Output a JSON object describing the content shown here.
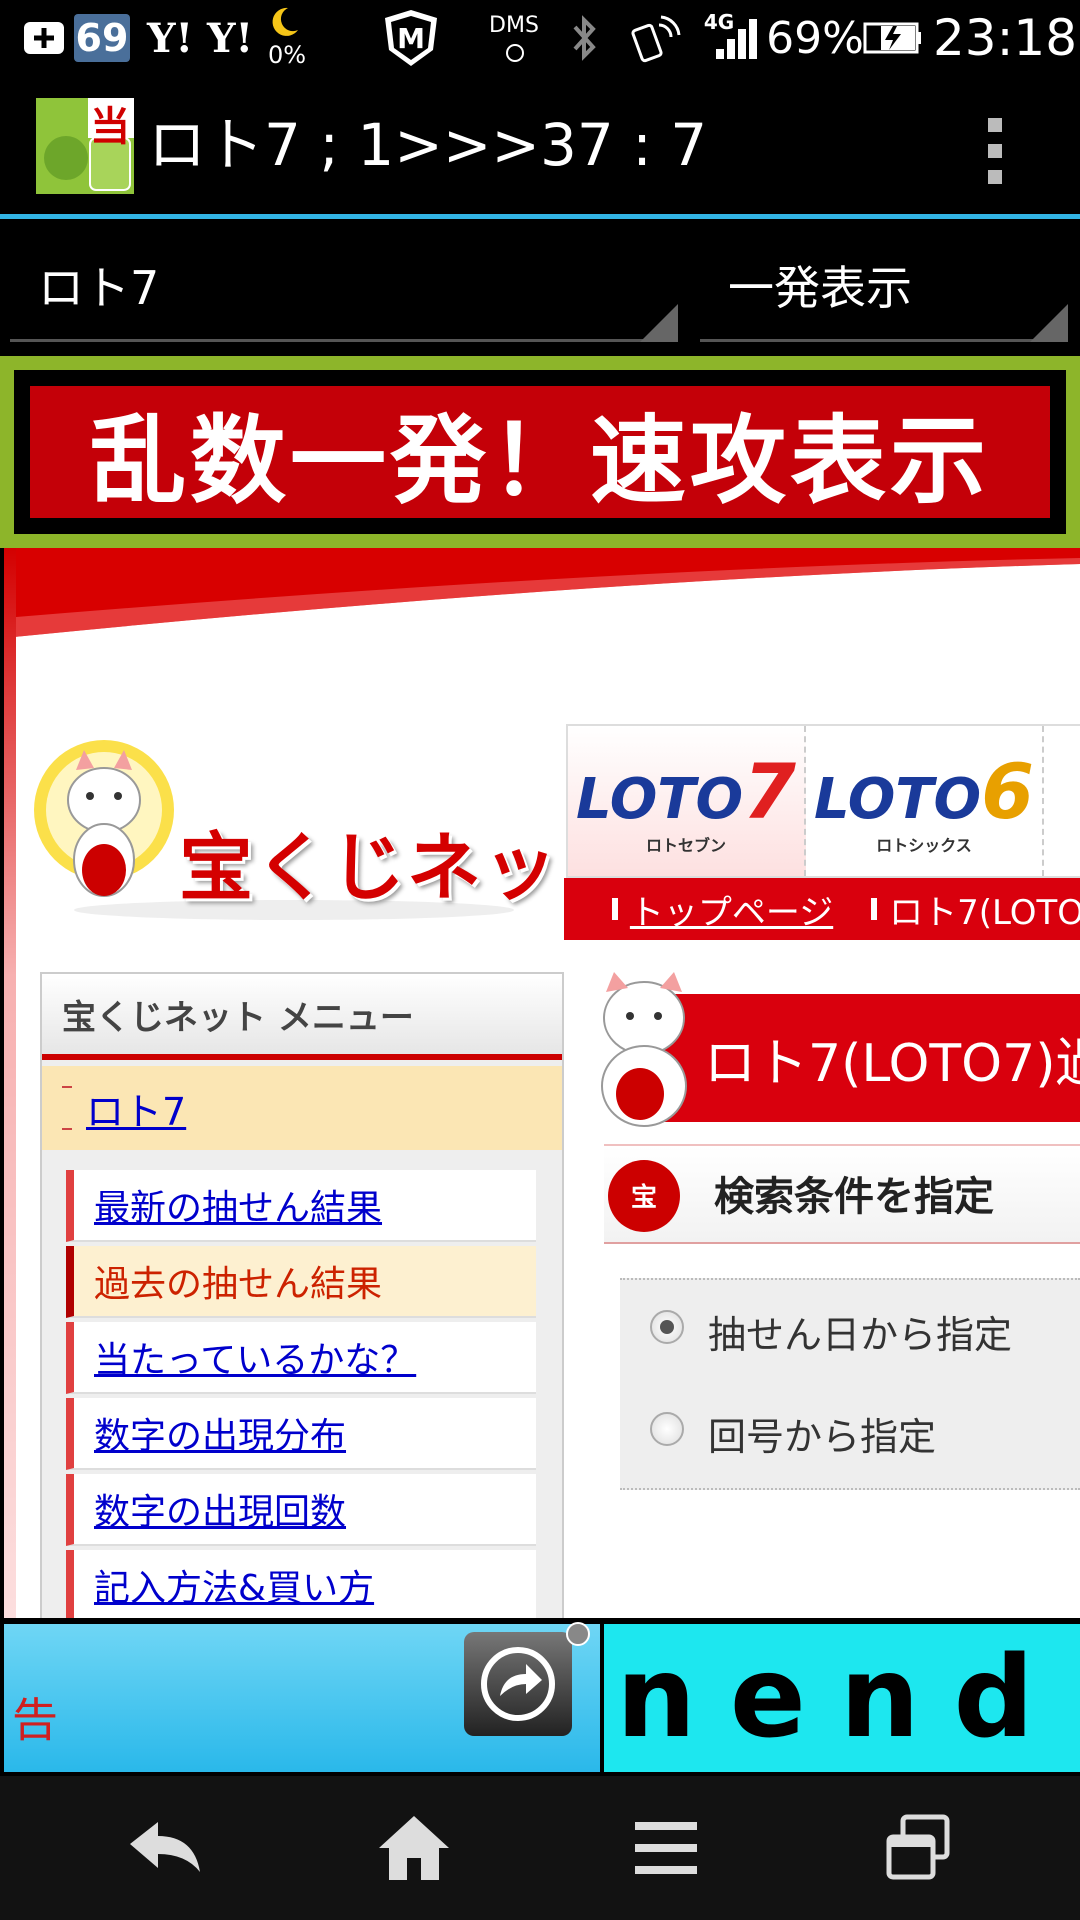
{
  "status_bar": {
    "notif_count": "69",
    "yahoo1": "Y!",
    "yahoo2": "Y!",
    "moon_pct": "0%",
    "dms": "DMS",
    "network": "4G",
    "battery": "69%",
    "time": "23:18"
  },
  "action_bar": {
    "icon_badge": "当",
    "title": "ロト7 ; 1>>>37 : 7"
  },
  "spinners": {
    "lottery": "ロト7",
    "mode": "一発表示"
  },
  "big_button": {
    "label": "乱数一発！速攻表示"
  },
  "webpage": {
    "logo_text": "宝くじネット",
    "loto_tabs": [
      {
        "main": "LOTO",
        "num": "7",
        "sub": "ロトセブン"
      },
      {
        "main": "LOTO",
        "num": "6",
        "sub": "ロトシックス"
      }
    ],
    "breadcrumb": {
      "top": "トップページ",
      "current": "ロト7(LOTO"
    },
    "menu": {
      "header": "宝くじネット メニュー",
      "sub": "ロト7",
      "items": [
        "最新の抽せん結果",
        "過去の抽せん結果",
        "当たっているかな？",
        "数字の出現分布",
        "数字の出現回数",
        "記入方法&買い方"
      ]
    },
    "page_title": "ロト7(LOTO7)過",
    "search": {
      "heading": "検索条件を指定",
      "option1": "抽せん日から指定",
      "option2": "回号から指定"
    }
  },
  "ads": {
    "ad1_text": "告",
    "ad2_text": "nend"
  },
  "colors": {
    "accent_blue": "#33b5e5",
    "brand_red": "#d9000d",
    "button_green": "#8db52a"
  }
}
